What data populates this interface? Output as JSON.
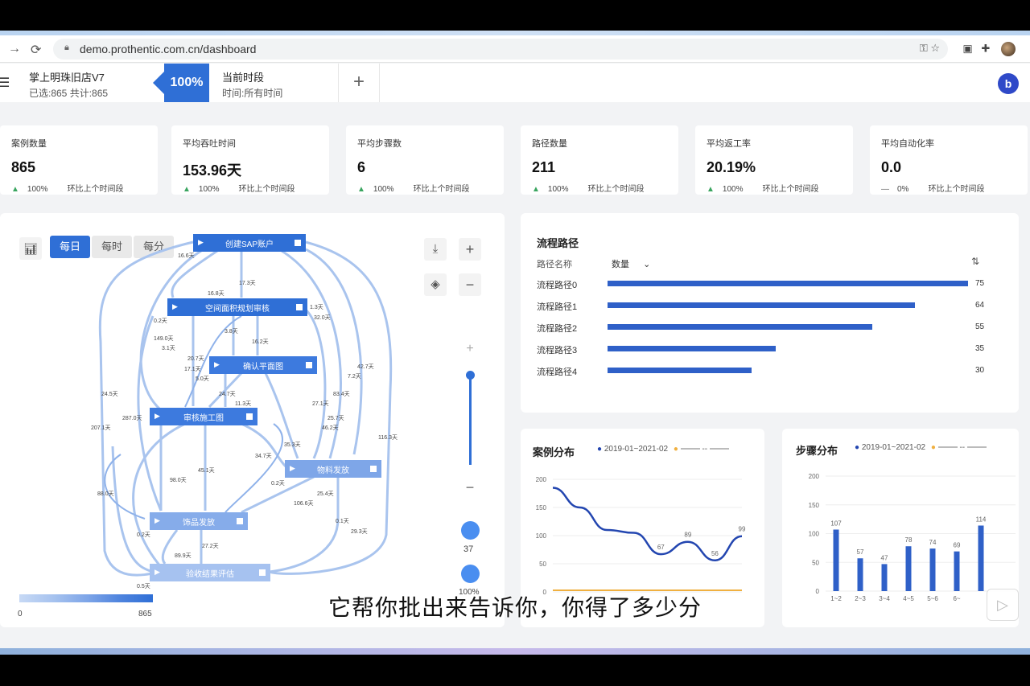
{
  "browser": {
    "url": "demo.prothentic.com.cn/dashboard"
  },
  "header": {
    "store_title": "掌上明珠旧店V7",
    "store_sub": "已选:865 共计:865",
    "percent": "100%",
    "period_title": "当前时段",
    "period_sub": "时间:所有时间",
    "add_label": "+",
    "avatar": "b"
  },
  "kpis": [
    {
      "label": "案例数量",
      "value": "865",
      "delta": "100%",
      "compare": "环比上个时间段",
      "trend": "up"
    },
    {
      "label": "平均吞吐时间",
      "value": "153.96天",
      "delta": "100%",
      "compare": "环比上个时间段",
      "trend": "up"
    },
    {
      "label": "平均步骤数",
      "value": "6",
      "delta": "100%",
      "compare": "环比上个时间段",
      "trend": "up"
    },
    {
      "label": "路径数量",
      "value": "211",
      "delta": "100%",
      "compare": "环比上个时间段",
      "trend": "up"
    },
    {
      "label": "平均返工率",
      "value": "20.19%",
      "delta": "100%",
      "compare": "环比上个时间段",
      "trend": "up"
    },
    {
      "label": "平均自动化率",
      "value": "0.0",
      "delta": "0%",
      "compare": "环比上个时间段",
      "trend": "flat"
    }
  ],
  "process_map": {
    "granularity": [
      "每日",
      "每时",
      "每分"
    ],
    "active_granularity": "每日",
    "nodes": [
      "创建SAP账户",
      "空间面积规划审核",
      "确认平面图",
      "审核施工图",
      "物料发放",
      "饰品发放",
      "验收结果评估"
    ],
    "edge_labels": [
      "16.6天",
      "17.3天",
      "16.8天",
      "1.3天",
      "32.0天",
      "0.2天",
      "3.8天",
      "149.0天",
      "16.2天",
      "3.1天",
      "20.7天",
      "17.1天",
      "5.0天",
      "24.7天",
      "11.3天",
      "7.2天",
      "42.7天",
      "27.1天",
      "83.4天",
      "24.5天",
      "287.0天",
      "25.7天",
      "46.2天",
      "207.1天",
      "34.7天",
      "35.3天",
      "116.3天",
      "45.1天",
      "98.0天",
      "0.2天",
      "25.4天",
      "88.0天",
      "106.6天",
      "0.1天",
      "29.3天",
      "0.2天",
      "27.2天",
      "89.9天",
      "0.5天"
    ],
    "legend_min": "0",
    "legend_max": "865",
    "slider_value": "37",
    "slider_percent": "100%"
  },
  "routes": {
    "title": "流程路径",
    "col_name": "路径名称",
    "col_count": "数量",
    "sort_icon": "sort-icon",
    "rows": [
      {
        "name": "流程路径0",
        "value": 75
      },
      {
        "name": "流程路径1",
        "value": 64
      },
      {
        "name": "流程路径2",
        "value": 55
      },
      {
        "name": "流程路径3",
        "value": 35
      },
      {
        "name": "流程路径4",
        "value": 30
      }
    ]
  },
  "case_dist": {
    "title": "案例分布",
    "legend": "2019-01~2021-02",
    "legend2": "--"
  },
  "step_dist": {
    "title": "步骤分布",
    "legend": "2019-01~2021-02",
    "legend2": "--"
  },
  "chart_data": [
    {
      "type": "line",
      "title": "案例分布",
      "series": [
        {
          "name": "2019-01~2021-02",
          "values": [
            185,
            150,
            110,
            105,
            67,
            89,
            56,
            99
          ]
        }
      ],
      "annotations": [
        "67",
        "89",
        "56",
        "99"
      ],
      "ylim": [
        0,
        200
      ],
      "yticks": [
        0,
        50,
        100,
        150,
        200
      ]
    },
    {
      "type": "bar",
      "title": "步骤分布",
      "categories": [
        "1~2",
        "2~3",
        "3~4",
        "4~5",
        "5~6",
        "6~",
        ""
      ],
      "series": [
        {
          "name": "2019-01~2021-02",
          "values": [
            107,
            57,
            47,
            78,
            74,
            69,
            114
          ]
        }
      ],
      "ylim": [
        0,
        200
      ],
      "yticks": [
        0,
        50,
        100,
        150,
        200
      ]
    }
  ],
  "subtitle": "它帮你批出来告诉你，你得了多少分",
  "colors": {
    "accent": "#2f6fd6",
    "bar": "#2f60c8",
    "line": "#2346b0",
    "secondary_line": "#f0b040"
  }
}
